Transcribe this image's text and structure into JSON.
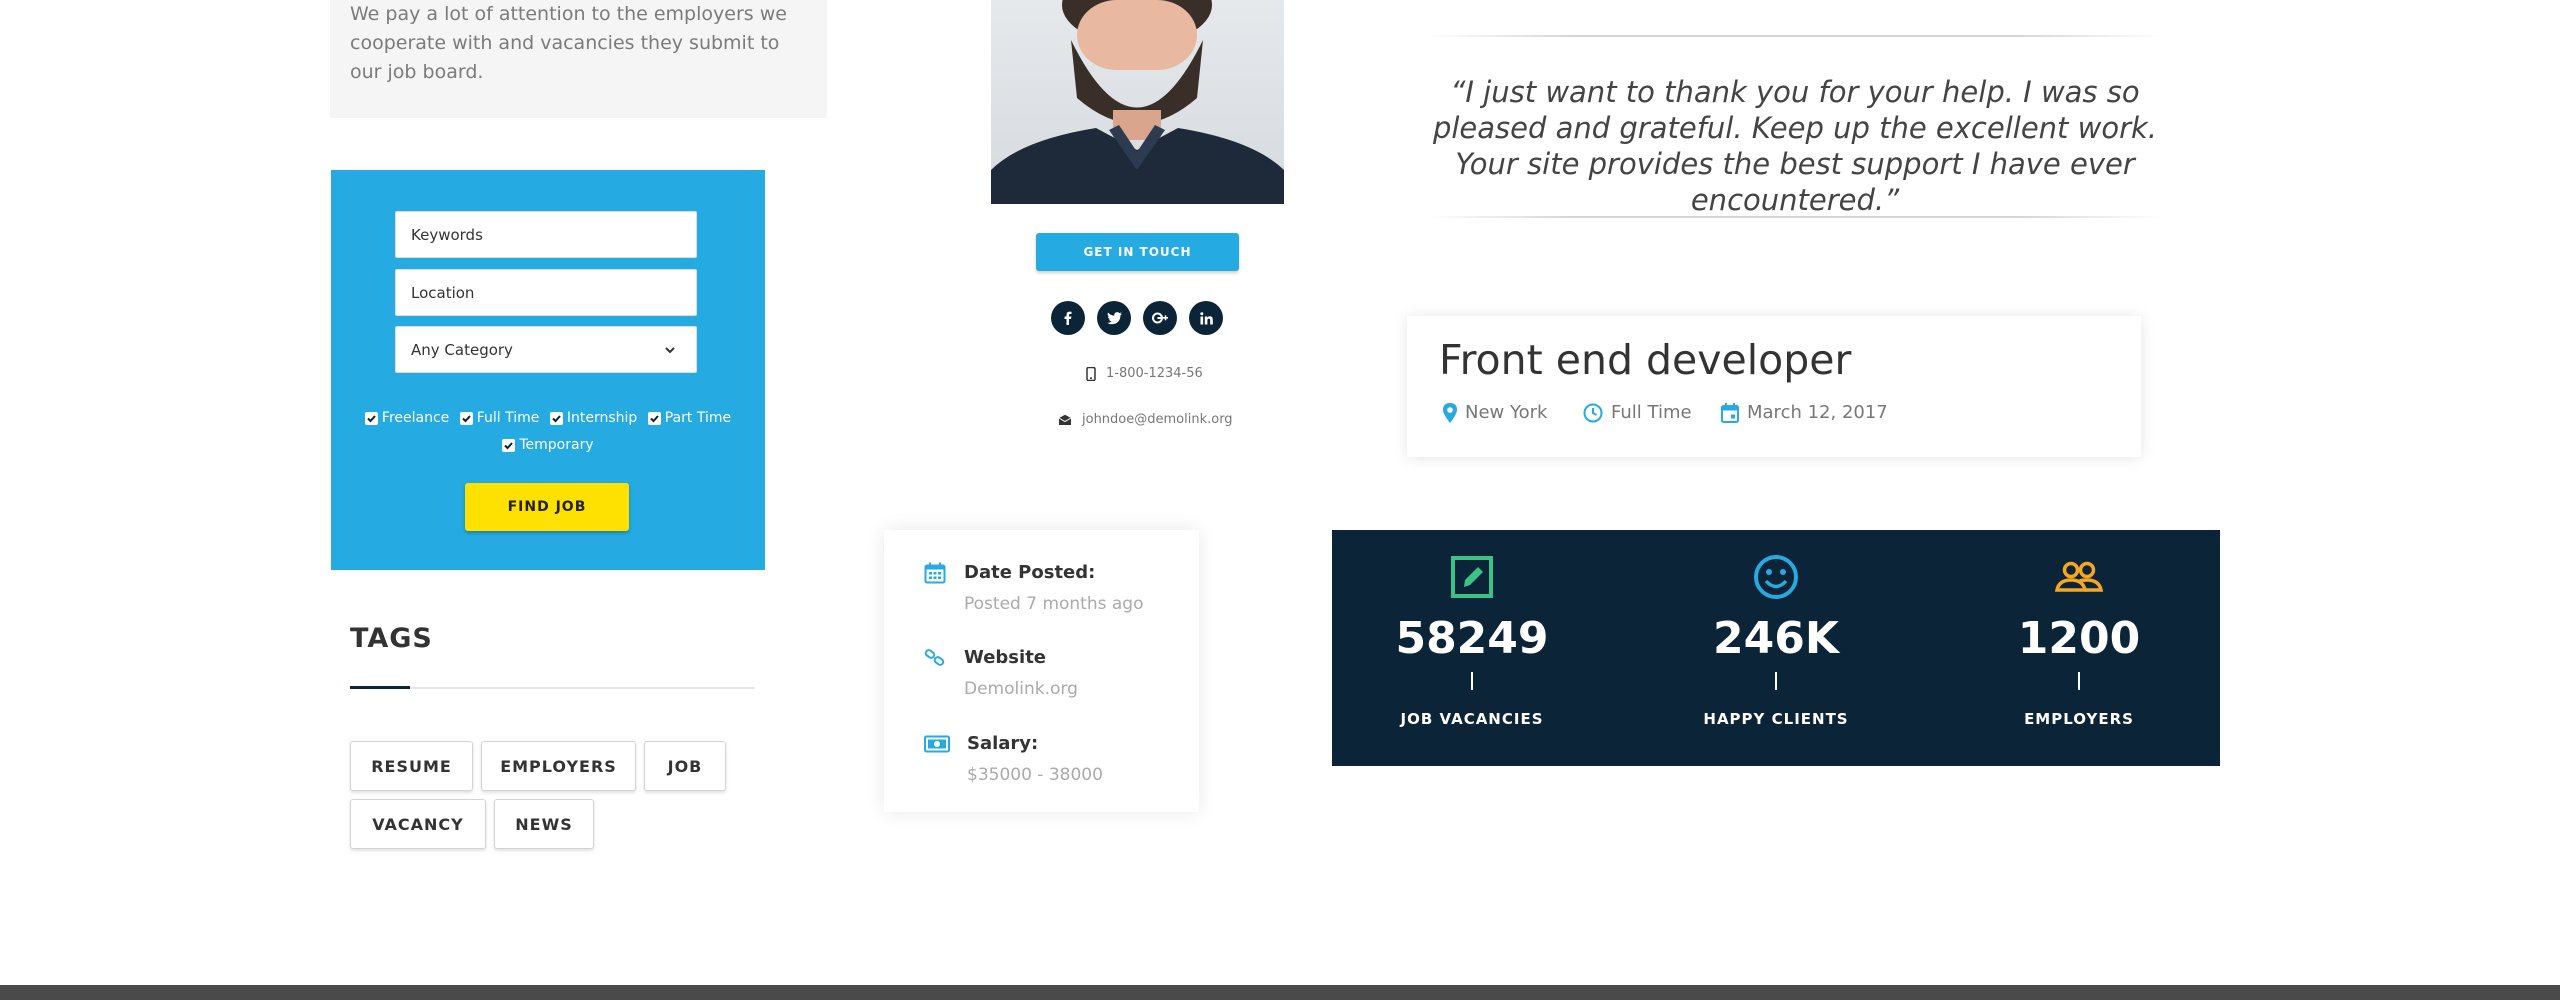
{
  "sidebar": {
    "intro_text": "We pay a lot of attention to the employers we cooperate with and vacancies they submit to our job board.",
    "search": {
      "keywords_placeholder": "Keywords",
      "location_placeholder": "Location",
      "category_selected": "Any Category",
      "job_types": [
        "Freelance",
        "Full Time",
        "Internship",
        "Part Time",
        "Temporary"
      ],
      "find_label": "FIND JOB"
    },
    "tags_title": "TAGS",
    "tags": [
      "RESUME",
      "EMPLOYERS",
      "JOB",
      "VACANCY",
      "NEWS"
    ]
  },
  "profile": {
    "get_in_touch": "GET IN TOUCH",
    "social_icons": [
      "facebook-icon",
      "twitter-icon",
      "google-plus-icon",
      "linkedin-icon"
    ],
    "phone": "1-800-1234-56",
    "email": "johndoe@demolink.org"
  },
  "job_details": {
    "date_label": "Date Posted:",
    "date_value": "Posted 7 months ago",
    "website_label": "Website",
    "website_value": "Demolink.org",
    "salary_label": "Salary:",
    "salary_value": "$35000 - 38000"
  },
  "testimonial": {
    "quote": "“I just want to thank you for your help. I was so pleased and grateful. Keep up the excellent work. Your site provides the best support I have ever encountered.”"
  },
  "job_card": {
    "title": "Front end developer",
    "location": "New York",
    "type": "Full Time",
    "date": "March 12, 2017"
  },
  "stats": [
    {
      "value": "58249",
      "label": "JOB VACANCIES",
      "icon": "edit-icon",
      "color": "#3bc284"
    },
    {
      "value": "246K",
      "label": "HAPPY CLIENTS",
      "icon": "smile-icon",
      "color": "#25aae2"
    },
    {
      "value": "1200",
      "label": "EMPLOYERS",
      "icon": "users-icon",
      "color": "#f5a623"
    }
  ],
  "colors": {
    "accent_blue": "#25aae2",
    "navy": "#0b2437",
    "yellow": "#ffe100"
  }
}
